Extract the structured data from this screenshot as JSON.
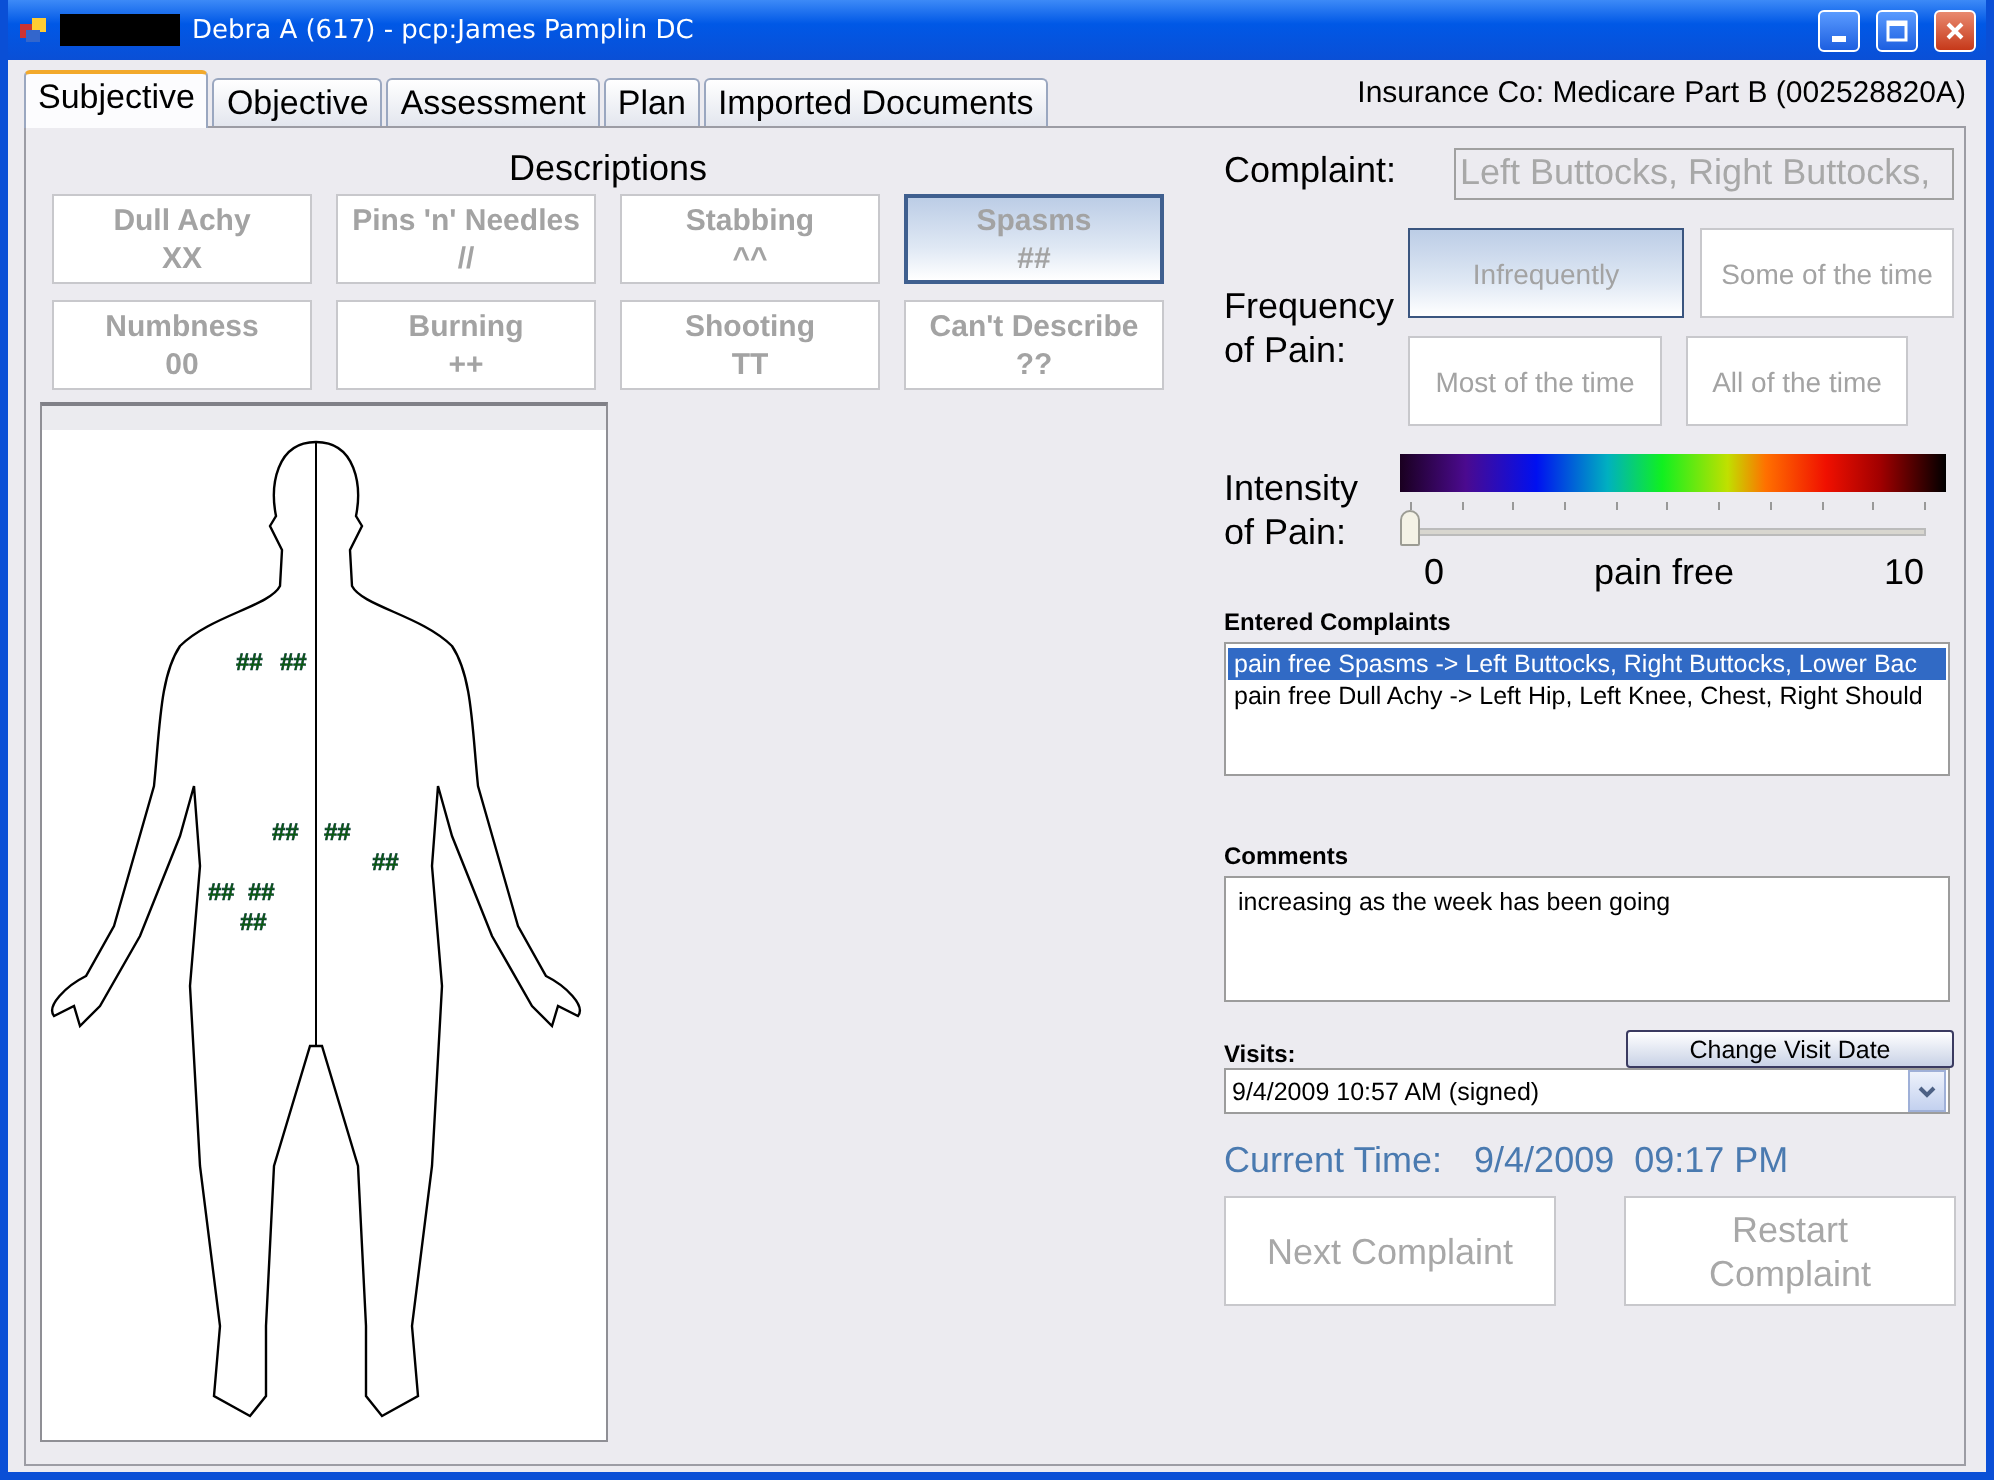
{
  "window": {
    "title": "Debra A (617) - pcp:James Pamplin DC"
  },
  "tabs": [
    {
      "label": "Subjective",
      "selected": true
    },
    {
      "label": "Objective",
      "selected": false
    },
    {
      "label": "Assessment",
      "selected": false
    },
    {
      "label": "Plan",
      "selected": false
    },
    {
      "label": "Imported Documents",
      "selected": false
    }
  ],
  "insurance": "Insurance Co: Medicare Part B (002528820A)",
  "descriptions": {
    "title": "Descriptions",
    "buttons": [
      {
        "label": "Dull Achy",
        "symbol": "XX",
        "selected": false
      },
      {
        "label": "Pins 'n' Needles",
        "symbol": "//",
        "selected": false
      },
      {
        "label": "Stabbing",
        "symbol": "^^",
        "selected": false
      },
      {
        "label": "Spasms",
        "symbol": "##",
        "selected": true
      },
      {
        "label": "Numbness",
        "symbol": "00",
        "selected": false
      },
      {
        "label": "Burning",
        "symbol": "++",
        "selected": false
      },
      {
        "label": "Shooting",
        "symbol": "TT",
        "selected": false
      },
      {
        "label": "Can't Describe",
        "symbol": "??",
        "selected": false
      }
    ]
  },
  "body_map": {
    "markers": [
      "##",
      "##",
      "##",
      "##",
      "##",
      "##",
      "##",
      "##"
    ]
  },
  "complaint": {
    "label": "Complaint:",
    "value": "Left Buttocks, Right Buttocks,"
  },
  "frequency": {
    "label": "Frequency of Pain:",
    "options": [
      {
        "label": "Infrequently",
        "selected": true
      },
      {
        "label": "Some of the time",
        "selected": false
      },
      {
        "label": "Most of the time",
        "selected": false
      },
      {
        "label": "All of the time",
        "selected": false
      }
    ]
  },
  "intensity": {
    "label": "Intensity of Pain:",
    "level": 0,
    "min": "0",
    "reading": "pain free",
    "max": "10"
  },
  "entered_complaints": {
    "label": "Entered Complaints",
    "items": [
      {
        "text": "pain free Spasms -> Left Buttocks, Right Buttocks, Lower Bac",
        "selected": true
      },
      {
        "text": "pain free Dull Achy -> Left Hip, Left Knee, Chest, Right Should",
        "selected": false
      }
    ]
  },
  "comments": {
    "label": "Comments",
    "value": "increasing as the week has been going"
  },
  "visits": {
    "label": "Visits:",
    "change_button": "Change Visit Date",
    "value": "9/4/2009 10:57 AM (signed)"
  },
  "current_time": {
    "label": "Current Time:",
    "value": "9/4/2009  09:17 PM"
  },
  "actions": [
    "Next Complaint",
    "Restart Complaint"
  ]
}
